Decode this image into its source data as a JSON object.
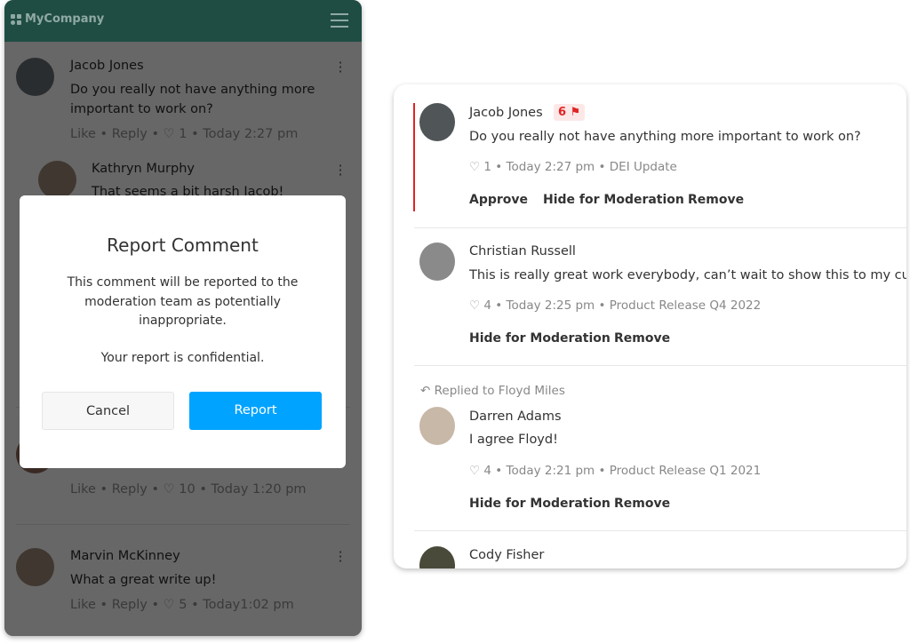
{
  "app": {
    "brand": "MyCompany"
  },
  "feed": [
    {
      "name": "Jacob Jones",
      "text": "Do you really not have anything more important to work on?",
      "like": "Like",
      "reply": "Reply",
      "likes": "1",
      "time": "Today 2:27 pm"
    },
    {
      "name": "Kathryn Murphy",
      "text": "That seems a bit harsh Jacob!"
    },
    {
      "like": "Like",
      "reply": "Reply",
      "likes": "10",
      "time": "Today 1:20 pm"
    },
    {
      "name": "Marvin McKinney",
      "text": "What a great write up!",
      "like": "Like",
      "reply": "Reply",
      "likes": "5",
      "time": "Today1:02 pm"
    }
  ],
  "modal": {
    "title": "Report Comment",
    "body": "This comment will be reported to the moderation team as potentially inappropriate.",
    "confidential": "Your report is confidential.",
    "cancel": "Cancel",
    "report": "Report"
  },
  "moderation": [
    {
      "name": "Jacob Jones",
      "flags": "6",
      "text": "Do you really not have anything more  important to work on?",
      "likes": "1",
      "time": "Today 2:27 pm",
      "topic": "DEI Update",
      "actions": [
        "Approve",
        "Hide for Moderation",
        "Remove"
      ]
    },
    {
      "name": "Christian Russell",
      "text": "This is really great work everybody, can’t wait to show this to my customers",
      "likes": "4",
      "time": "Today 2:25 pm",
      "topic": "Product Release Q4 2022",
      "actions": [
        "Hide for Moderation",
        "Remove"
      ]
    },
    {
      "replied_to": "Replied to Floyd Miles",
      "name": "Darren Adams",
      "text": "I agree Floyd!",
      "likes": "4",
      "time": "Today 2:21 pm",
      "topic": "Product Release Q1 2021",
      "actions": [
        "Hide for Moderation",
        "Remove"
      ]
    },
    {
      "name": "Cody Fisher"
    }
  ],
  "colors": {
    "brand": "#4cbfa9",
    "primary": "#00a3ff",
    "flag": "#e02424"
  }
}
